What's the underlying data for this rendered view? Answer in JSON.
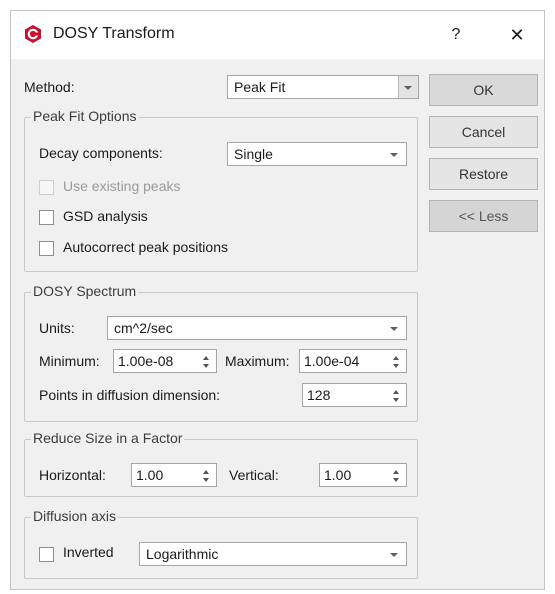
{
  "window": {
    "title": "DOSY Transform",
    "help": "?",
    "close": "✕"
  },
  "method": {
    "label": "Method:",
    "value": "Peak Fit"
  },
  "buttons": {
    "ok": "OK",
    "cancel": "Cancel",
    "restore": "Restore",
    "less": "<< Less"
  },
  "peak_fit": {
    "title": "Peak Fit Options",
    "decay_label": "Decay components:",
    "decay_value": "Single",
    "use_existing": "Use existing peaks",
    "gsd": "GSD analysis",
    "autocorrect": "Autocorrect peak positions"
  },
  "spectrum": {
    "title": "DOSY Spectrum",
    "units_label": "Units:",
    "units_value": "cm^2/sec",
    "min_label": "Minimum:",
    "min_value": "1.00e-08",
    "max_label": "Maximum:",
    "max_value": "1.00e-04",
    "points_label": "Points in diffusion dimension:",
    "points_value": "128"
  },
  "reduce": {
    "title": "Reduce Size in a Factor",
    "h_label": "Horizontal:",
    "h_value": "1.00",
    "v_label": "Vertical:",
    "v_value": "1.00"
  },
  "axis": {
    "title": "Diffusion axis",
    "inverted": "Inverted",
    "scale_value": "Logarithmic"
  },
  "colors": {
    "logo": "#c8102e",
    "dialog_bg": "#f0f0f0",
    "titlebar_bg": "#ffffff"
  },
  "icons": {
    "logo": "app-logo-icon",
    "help": "help-icon",
    "close": "close-icon"
  }
}
